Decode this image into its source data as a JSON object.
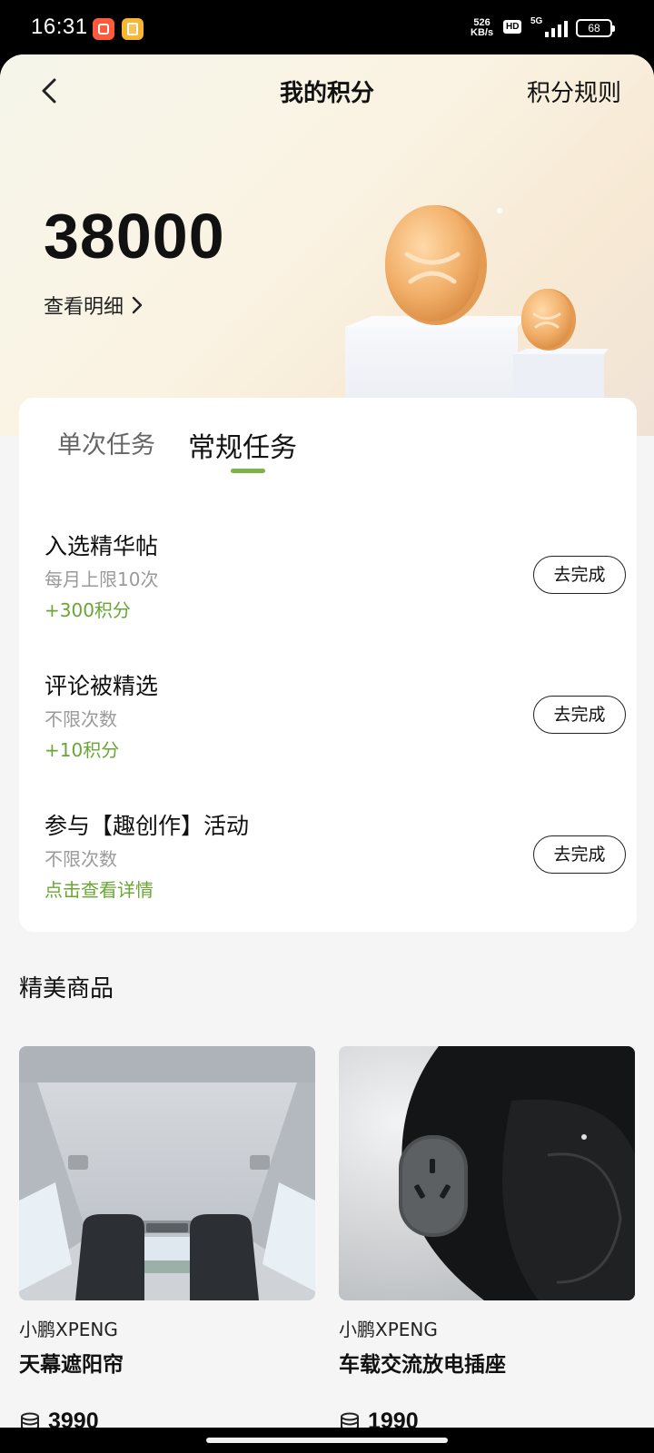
{
  "status_bar": {
    "time": "16:31",
    "speed_value": "526",
    "speed_unit": "KB/s",
    "hd": "HD",
    "network": "5G",
    "battery": "68"
  },
  "header": {
    "title": "我的积分",
    "rules_label": "积分规则"
  },
  "points": {
    "value": "38000",
    "details_label": "查看明细"
  },
  "tabs": [
    {
      "label": "单次任务",
      "active": false
    },
    {
      "label": "常规任务",
      "active": true
    }
  ],
  "tasks": [
    {
      "title": "入选精华帖",
      "limit": "每月上限10次",
      "reward": "+300积分",
      "button": "去完成"
    },
    {
      "title": "评论被精选",
      "limit": "不限次数",
      "reward": "+10积分",
      "button": "去完成"
    },
    {
      "title": "参与【趣创作】活动",
      "limit": "不限次数",
      "reward": "点击查看详情",
      "button": "去完成"
    }
  ],
  "products_section": {
    "title": "精美商品",
    "items": [
      {
        "brand": "小鹏XPENG",
        "name": "天幕遮阳帘",
        "price": "3990"
      },
      {
        "brand": "小鹏XPENG",
        "name": "车载交流放电插座",
        "price": "1990"
      }
    ]
  },
  "colors": {
    "accent_green": "#7fb24a",
    "reward_green": "#6aa535",
    "coin_gold": "#f2b06a"
  }
}
